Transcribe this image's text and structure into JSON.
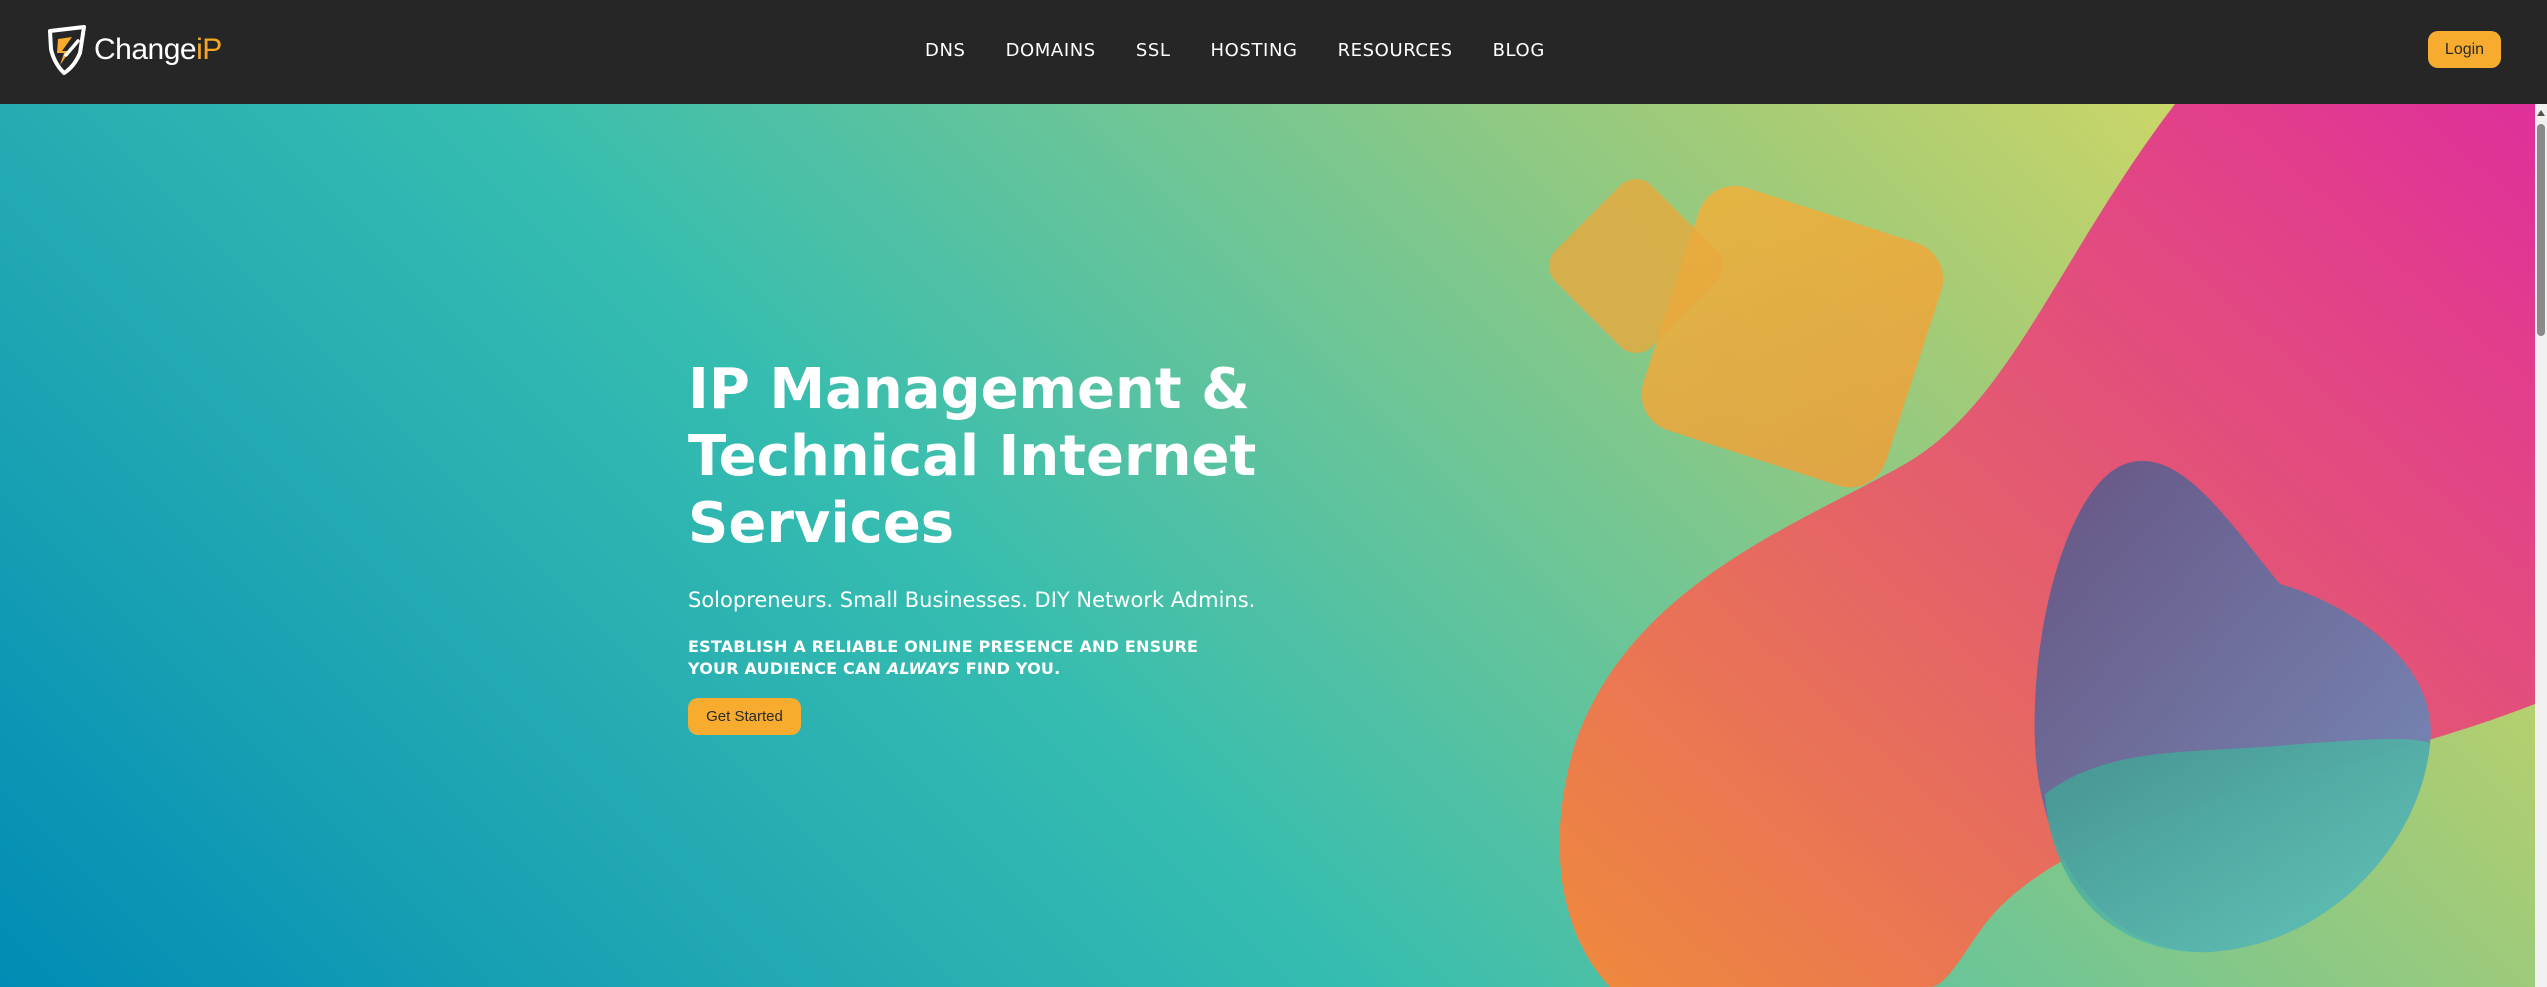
{
  "header": {
    "logo": {
      "text_main": "Change",
      "text_accent": "iP",
      "icon": "shield-logo-icon"
    },
    "nav": [
      {
        "label": "DNS"
      },
      {
        "label": "DOMAINS"
      },
      {
        "label": "SSL"
      },
      {
        "label": "HOSTING"
      },
      {
        "label": "RESOURCES"
      },
      {
        "label": "BLOG"
      }
    ],
    "login_label": "Login"
  },
  "hero": {
    "title": "IP Management & Technical Internet Services",
    "subtitle": "Solopreneurs. Small Businesses. DIY Network Admins.",
    "description_before": "ESTABLISH A RELIABLE ONLINE PRESENCE AND ENSURE YOUR AUDIENCE CAN ",
    "description_emphasis": "ALWAYS",
    "description_after": " FIND YOU.",
    "cta_label": "Get Started"
  },
  "colors": {
    "header_bg": "#262626",
    "accent": "#f7ac2f",
    "hero_gradient_from": "#008cb4",
    "hero_gradient_mid": "#36bdb0",
    "hero_gradient_to": "#e9df5c",
    "blob_pink": "#e0338f",
    "blob_orange": "#ef8a3c",
    "blob_purple": "#5e5a8a"
  },
  "scrollbar": {
    "position_fraction": 0.0
  }
}
